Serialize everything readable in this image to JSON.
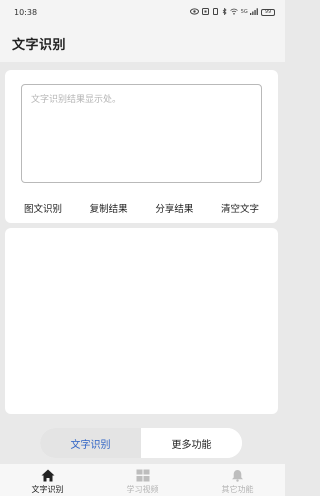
{
  "status_bar": {
    "time": "10:38",
    "battery": "99",
    "signal_text": "5G"
  },
  "header": {
    "title": "文字识别"
  },
  "result": {
    "placeholder": "文字识别结果显示处。"
  },
  "actions": [
    {
      "label": "图文识别"
    },
    {
      "label": "复制结果"
    },
    {
      "label": "分享结果"
    },
    {
      "label": "清空文字"
    }
  ],
  "segmented": {
    "active": "文字识别",
    "inactive": "更多功能",
    "active_color": "#2f63c5"
  },
  "tabbar": [
    {
      "label": "文字识别",
      "icon": "home-icon",
      "active": true
    },
    {
      "label": "学习视频",
      "icon": "grid-icon",
      "active": false
    },
    {
      "label": "其它功能",
      "icon": "bell-icon",
      "active": false
    }
  ]
}
